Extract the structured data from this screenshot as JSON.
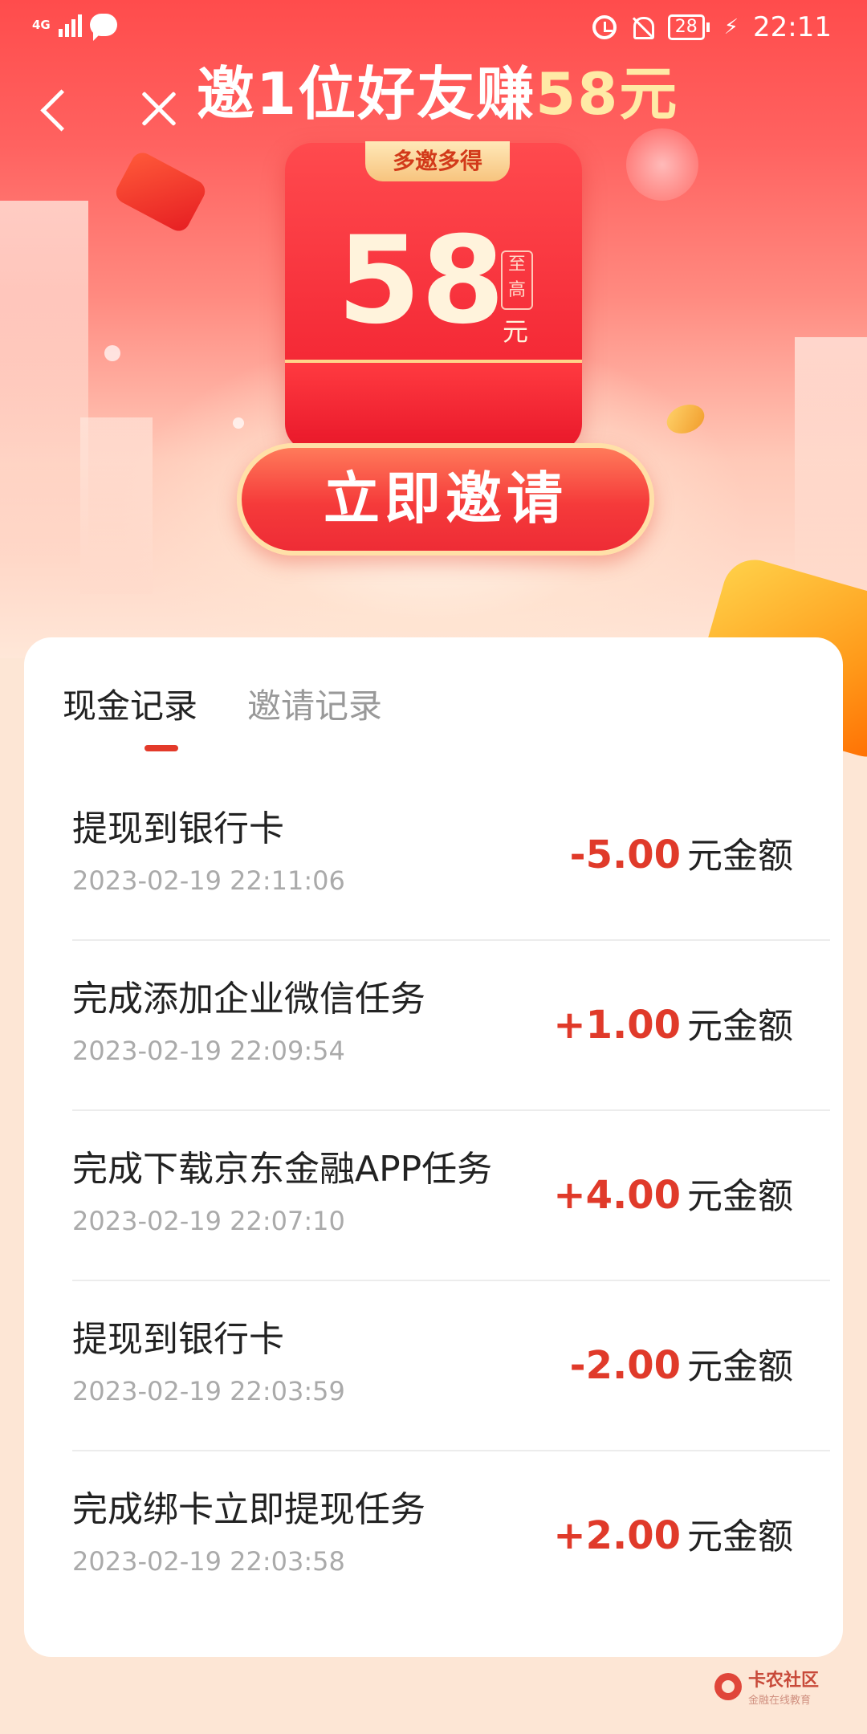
{
  "status_bar": {
    "network": "4G",
    "battery": "28",
    "time": "22:11"
  },
  "header": {
    "title_prefix": "邀1位好友赚",
    "title_amount": "58元"
  },
  "envelope": {
    "tag": "多邀多得",
    "amount": "58",
    "prefix": "至高",
    "unit": "元"
  },
  "invite_button": "立即邀请",
  "tabs": [
    {
      "label": "现金记录",
      "active": true
    },
    {
      "label": "邀请记录",
      "active": false
    }
  ],
  "records": [
    {
      "title": "提现到银行卡",
      "time": "2023-02-19 22:11:06",
      "amount": "-5.00",
      "unit": "元金额"
    },
    {
      "title": "完成添加企业微信任务",
      "time": "2023-02-19 22:09:54",
      "amount": "+1.00",
      "unit": "元金额"
    },
    {
      "title": "完成下载京东金融APP任务",
      "time": "2023-02-19 22:07:10",
      "amount": "+4.00",
      "unit": "元金额"
    },
    {
      "title": "提现到银行卡",
      "time": "2023-02-19 22:03:59",
      "amount": "-2.00",
      "unit": "元金额"
    },
    {
      "title": "完成绑卡立即提现任务",
      "time": "2023-02-19 22:03:58",
      "amount": "+2.00",
      "unit": "元金额"
    }
  ],
  "watermark": {
    "main": "卡农社区",
    "sub": "金融在线教育"
  },
  "colors": {
    "accent_red": "#e03a2a",
    "hero_red": "#ff4c4c",
    "gold": "#ffeaa6"
  }
}
